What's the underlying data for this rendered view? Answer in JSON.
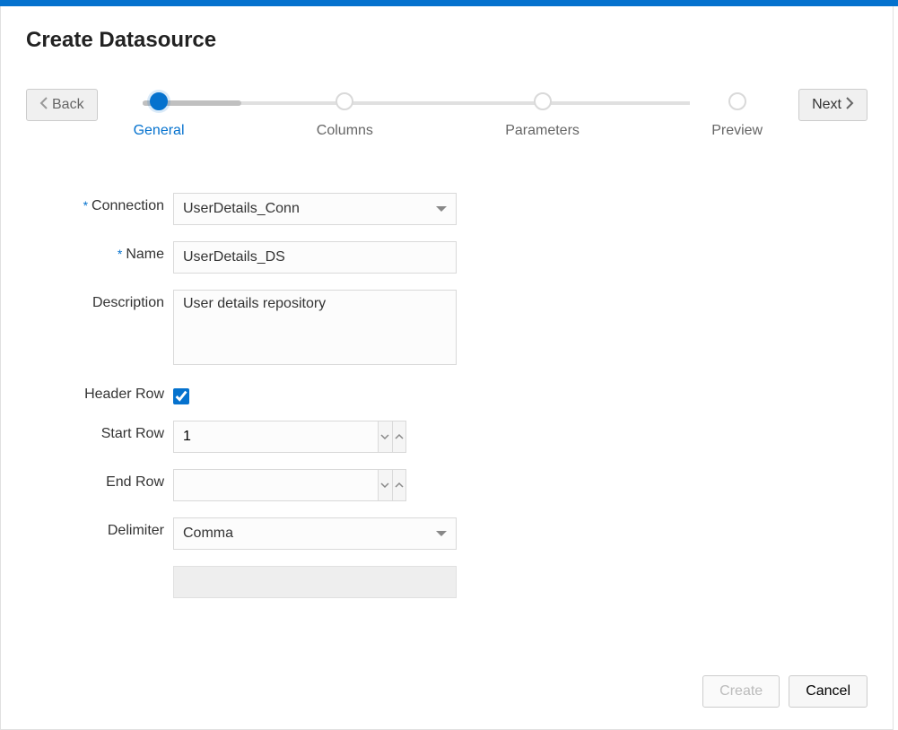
{
  "title": "Create Datasource",
  "nav": {
    "back": "Back",
    "next": "Next"
  },
  "steps": [
    {
      "label": "General",
      "active": true
    },
    {
      "label": "Columns",
      "active": false
    },
    {
      "label": "Parameters",
      "active": false
    },
    {
      "label": "Preview",
      "active": false
    }
  ],
  "form": {
    "connection": {
      "label": "Connection",
      "value": "UserDetails_Conn"
    },
    "name": {
      "label": "Name",
      "value": "UserDetails_DS"
    },
    "description": {
      "label": "Description",
      "value": "User details repository"
    },
    "headerRow": {
      "label": "Header Row",
      "checked": true
    },
    "startRow": {
      "label": "Start Row",
      "value": "1"
    },
    "endRow": {
      "label": "End Row",
      "value": ""
    },
    "delimiter": {
      "label": "Delimiter",
      "value": "Comma"
    }
  },
  "footer": {
    "create": "Create",
    "cancel": "Cancel"
  }
}
